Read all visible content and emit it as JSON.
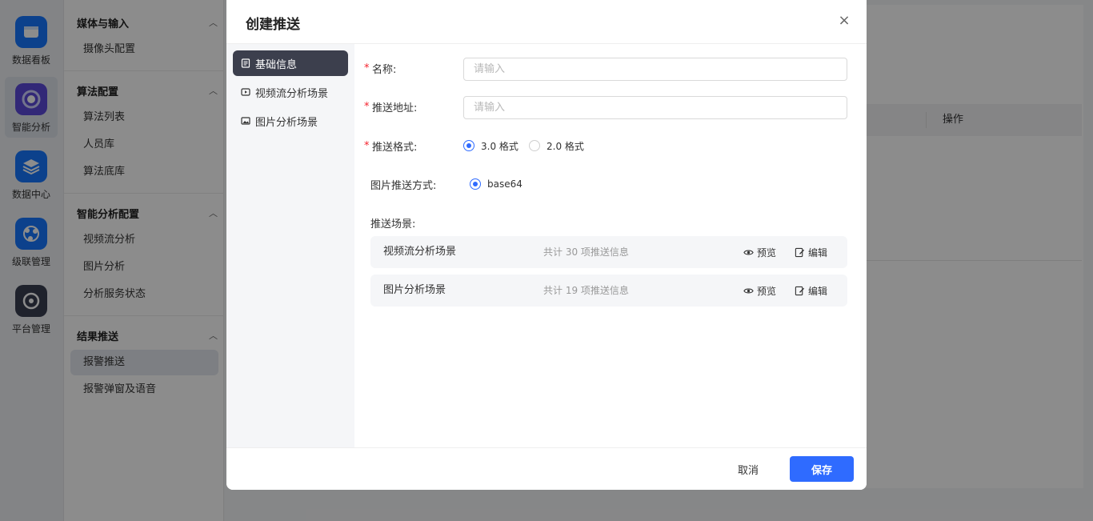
{
  "colors": {
    "accent": "#2f6bff",
    "required": "#f5222d",
    "nav_active": "#3c3f4d"
  },
  "rail": {
    "items": [
      {
        "label": "数据看板",
        "icon": "dashboard-icon"
      },
      {
        "label": "智能分析",
        "icon": "ai-analysis-icon",
        "active": true
      },
      {
        "label": "数据中心",
        "icon": "layers-icon"
      },
      {
        "label": "级联管理",
        "icon": "cascade-icon"
      },
      {
        "label": "平台管理",
        "icon": "settings-icon"
      }
    ]
  },
  "sidebar": {
    "groups": [
      {
        "title": "媒体与输入",
        "items": [
          "摄像头配置"
        ]
      },
      {
        "title": "算法配置",
        "items": [
          "算法列表",
          "人员库",
          "算法底库"
        ]
      },
      {
        "title": "智能分析配置",
        "items": [
          "视频流分析",
          "图片分析",
          "分析服务状态"
        ]
      },
      {
        "title": "结果推送",
        "items": [
          "报警推送",
          "报警弹窗及语音"
        ],
        "active_item": "报警推送"
      }
    ]
  },
  "background_table": {
    "op_header": "操作"
  },
  "dialog": {
    "title": "创建推送",
    "close_label": "×",
    "nav": [
      {
        "label": "基础信息",
        "icon": "document-icon",
        "active": true
      },
      {
        "label": "视频流分析场景",
        "icon": "video-icon"
      },
      {
        "label": "图片分析场景",
        "icon": "image-icon"
      }
    ],
    "form": {
      "name": {
        "label": "名称:",
        "placeholder": "请输入",
        "value": ""
      },
      "address": {
        "label": "推送地址:",
        "placeholder": "请输入",
        "value": ""
      },
      "format": {
        "label": "推送格式:",
        "options": [
          "3.0 格式",
          "2.0 格式"
        ],
        "selected": "3.0 格式"
      },
      "image_mode": {
        "label": "图片推送方式:",
        "options": [
          "base64"
        ],
        "selected": "base64"
      },
      "scenes_label": "推送场景:",
      "scenes": [
        {
          "name": "视频流分析场景",
          "count": "共计 30 项推送信息",
          "preview": "预览",
          "edit": "编辑"
        },
        {
          "name": "图片分析场景",
          "count": "共计 19 项推送信息",
          "preview": "预览",
          "edit": "编辑"
        }
      ]
    },
    "footer": {
      "cancel": "取消",
      "save": "保存"
    }
  }
}
